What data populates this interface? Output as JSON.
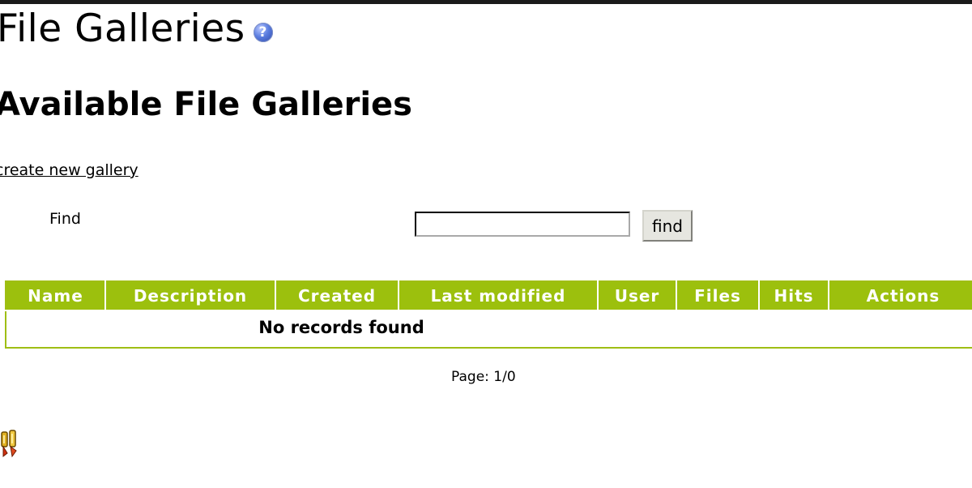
{
  "header": {
    "title": "File Galleries",
    "help_icon": "question-mark-icon"
  },
  "section": {
    "title": "Available File Galleries",
    "create_link": "create new gallery"
  },
  "search": {
    "label": "Find",
    "value": "",
    "button_label": "find"
  },
  "table": {
    "columns": [
      "Name",
      "Description",
      "Created",
      "Last modified",
      "User",
      "Files",
      "Hits",
      "Actions"
    ],
    "empty_message": "No records found"
  },
  "pagination": {
    "text": "Page: 1/0"
  },
  "footer": {
    "icon": "tools-icon"
  },
  "colors": {
    "header_green": "#9cc00d",
    "border_green": "#9fbe14"
  }
}
